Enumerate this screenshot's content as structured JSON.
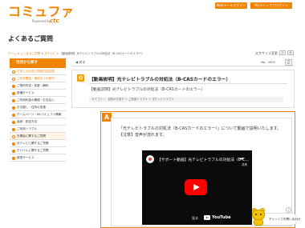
{
  "header": {
    "logo_main": "コミュファ",
    "logo_sub": "Powered by",
    "logo_brand": "ctc",
    "web_store_label": "Webメールログイン",
    "my_label": "Myコミュファログイン"
  },
  "page": {
    "title": "よくあるご質問"
  },
  "breadcrumb": {
    "home": "ホーム",
    "sep": " > ",
    "section1": "よくあるご質問",
    "section2": "光テレビ",
    "current": "【動画説明】光テレビトラブルの対処法（B-CASカードのエラー）"
  },
  "font_size": {
    "label": "文字サイズ変更",
    "small": "小",
    "large": "大"
  },
  "sidebar": {
    "heading": "目的から探す",
    "items": [
      {
        "label": "お申し込み及び契約内容変更",
        "kind": "sub"
      },
      {
        "label": "ご利用開始・増設までの案内",
        "kind": "sub"
      },
      {
        "label": "ご契約内容・変更・解約",
        "kind": "main"
      },
      {
        "label": "各種サービス",
        "kind": "main"
      },
      {
        "label": "ご利用料金の確認・お支払い",
        "kind": "main"
      },
      {
        "label": "お引越し・住所の変更",
        "kind": "main"
      },
      {
        "label": "ホームページ・Myコミュファ情報",
        "kind": "main"
      },
      {
        "label": "接続・設定方法",
        "kind": "main"
      },
      {
        "label": "ご利用トラブル",
        "kind": "main"
      },
      {
        "label": "光電話に関するご質問",
        "kind": "hl"
      },
      {
        "label": "光テレビに関するご質問",
        "kind": "main"
      },
      {
        "label": "モバイルに関するご質問",
        "kind": "main"
      },
      {
        "label": "経営サービス",
        "kind": "main"
      }
    ]
  },
  "main": {
    "back_label": "戻る",
    "faq_no": "No：2895",
    "question": {
      "mark": "Q",
      "title": "【動画説明】光テレビトラブルの対処法（B-CASカードのエラー）",
      "body": "【動画説明】光テレビトラブルの対処法（B-CASカードのエラー）",
      "categories": "カテゴリー：目的から探す ＞ ご利用トラブル ＞ 光テレビトラブル"
    },
    "answer": {
      "mark": "A",
      "line1": "「光テレビトラブルの対処法（B-CASカードのエラー）」について動画で説明いたします。",
      "line2": "【注意】音声が流れます。"
    },
    "video": {
      "title": "【サポート動画】光テレビトラブルの対処法（B-C…",
      "share": "共有",
      "watch_on": "見る",
      "platform": "YouTube"
    }
  },
  "chat": {
    "label": "チャットでお問い合わせ"
  },
  "colors": {
    "accent": "#f08300",
    "question_icon": "#f5a200",
    "youtube_red": "#ff0000"
  }
}
